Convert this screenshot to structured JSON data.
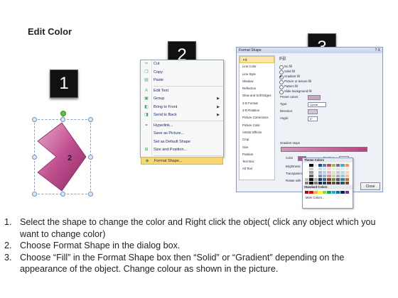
{
  "title": "Edit Color",
  "badges": [
    "1",
    "2",
    "3"
  ],
  "shape": {
    "label": "2",
    "fill_color": "#c04f8f"
  },
  "context_menu": {
    "items": [
      {
        "label": "Cut",
        "icon": "scissors-icon"
      },
      {
        "label": "Copy",
        "icon": "copy-icon"
      },
      {
        "label": "Paste",
        "icon": "paste-icon"
      },
      {
        "label": "Edit Text",
        "icon": "edit-text-icon"
      },
      {
        "label": "Group",
        "icon": "group-icon",
        "submenu": true
      },
      {
        "label": "Bring to Front",
        "icon": "bring-front-icon",
        "submenu": true
      },
      {
        "label": "Send to Back",
        "icon": "send-back-icon",
        "submenu": true
      },
      {
        "label": "Hyperlink...",
        "icon": "hyperlink-icon"
      },
      {
        "label": "Save as Picture...",
        "icon": ""
      },
      {
        "label": "Set as Default Shape",
        "icon": ""
      },
      {
        "label": "Size and Position...",
        "icon": "size-position-icon"
      },
      {
        "label": "Format Shape...",
        "icon": "format-shape-icon",
        "highlighted": true
      }
    ]
  },
  "dialog": {
    "title": "Format Shape",
    "close_x": "?  X",
    "nav": [
      "Fill",
      "Line Color",
      "Line Style",
      "Shadow",
      "Reflection",
      "Glow and Soft Edges",
      "3-D Format",
      "3-D Rotation",
      "Picture Corrections",
      "Picture Color",
      "Artistic Effects",
      "Crop",
      "Size",
      "Position",
      "Text Box",
      "Alt Text"
    ],
    "fill_heading": "Fill",
    "fill_options": [
      "No fill",
      "Solid fill",
      "Gradient fill",
      "Picture or texture fill",
      "Pattern fill",
      "Slide background fill"
    ],
    "preset_colors_label": "Preset colors:",
    "type_label": "Type:",
    "type_value": "Linear",
    "direction_label": "Direction:",
    "angle_label": "Angle:",
    "angle_value": "0°",
    "gradient_stops_label": "Gradient stops",
    "color_label": "Color",
    "position_label": "Position:",
    "position_value": "0%",
    "brightness_label": "Brightness:",
    "transparency_label": "Transparency:",
    "rotate_label": "Rotate with shape",
    "close_button": "Close"
  },
  "palette": {
    "theme_heading": "Theme Colors",
    "standard_heading": "Standard Colors",
    "more_label": "More Colors...",
    "theme_top": [
      "#ffffff",
      "#000000",
      "#eeece1",
      "#1f497d",
      "#4f81bd",
      "#c0504d",
      "#9bbb59",
      "#8064a2",
      "#4bacc6",
      "#f79646"
    ],
    "standard": [
      "#c00000",
      "#ff0000",
      "#ffc000",
      "#ffff00",
      "#92d050",
      "#00b050",
      "#00b0f0",
      "#0070c0",
      "#002060",
      "#7030a0"
    ]
  },
  "instructions": [
    {
      "num": "1.",
      "text": "Select the shape to change the color and Right click the object( click any object which you want to change color)"
    },
    {
      "num": "2.",
      "text": "Choose Format Shape in the dialog box."
    },
    {
      "num": "3.",
      "text": "Choose “Fill” in the Format Shape box then “Solid” or “Gradient” depending on the appearance of the object. Change colour as shown in the picture."
    }
  ]
}
